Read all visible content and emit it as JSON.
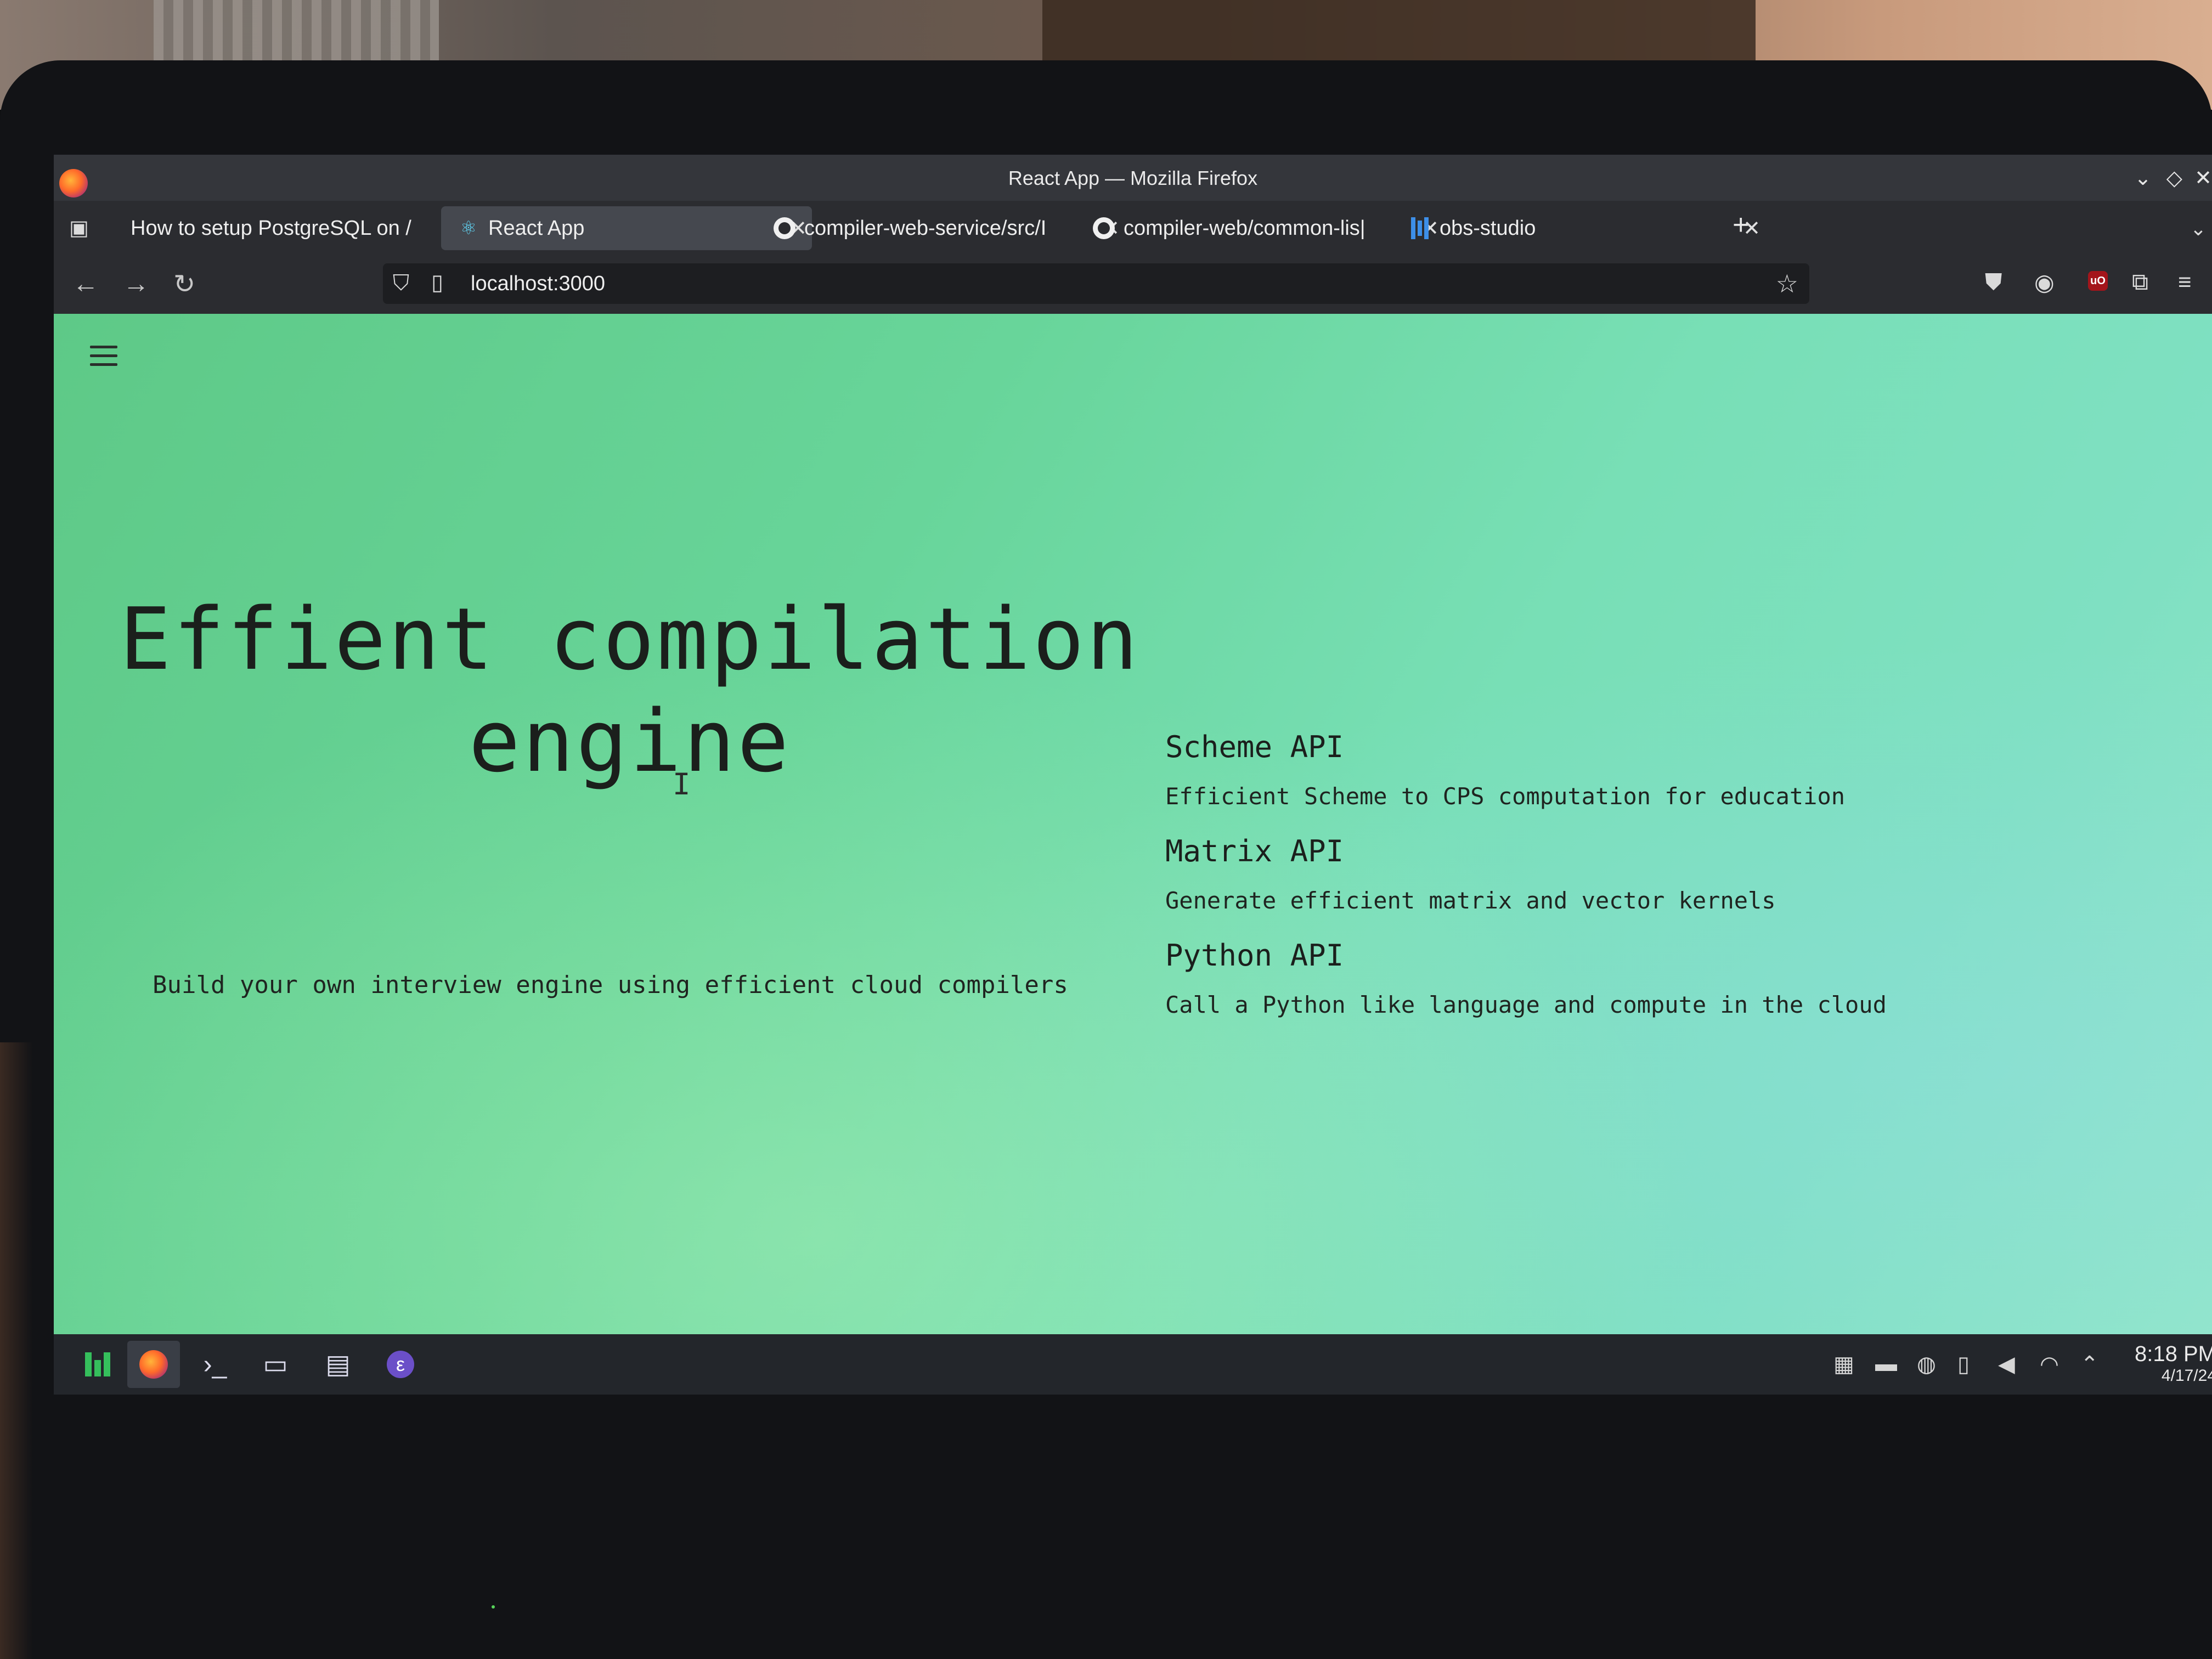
{
  "window": {
    "title": "React App — Mozilla Firefox",
    "controls": [
      "⌄",
      "◇",
      "✕"
    ]
  },
  "tabs": [
    {
      "label": "How to setup PostgreSQL on /",
      "icon": "none",
      "active": false
    },
    {
      "label": "React App",
      "icon": "react-icon",
      "active": true
    },
    {
      "label": "compiler-web-service/src/I",
      "icon": "github-icon",
      "active": false
    },
    {
      "label": "compiler-web/common-lis|",
      "icon": "github-icon",
      "active": false
    },
    {
      "label": "obs-studio",
      "icon": "obs-icon",
      "active": false
    }
  ],
  "tab_close_glyph": "✕",
  "new_tab_glyph": "+",
  "navbar": {
    "url": "localhost:3000"
  },
  "page": {
    "hero_title": "Effient compilation engine",
    "hero_subtitle": "Build your own interview engine using efficient cloud compilers",
    "apis": [
      {
        "name": "Scheme API",
        "description": "Efficient Scheme to CPS computation for education"
      },
      {
        "name": "Matrix API",
        "description": "Generate efficient matrix and vector kernels"
      },
      {
        "name": "Python API",
        "description": "Call a Python like language and compute in the cloud"
      }
    ],
    "background_color": "#6fd8a6"
  },
  "taskbar": {
    "apps": [
      "app-launcher-icon",
      "firefox-icon",
      "terminal-icon",
      "file-manager-icon",
      "document-viewer-icon",
      "emacs-icon"
    ],
    "tray": [
      "keyboard-icon",
      "display-icon",
      "update-icon",
      "clipboard-icon",
      "volume-icon",
      "wifi-icon",
      "chevron-up-icon"
    ],
    "time": "8:18 PM",
    "date": "4/17/24"
  }
}
